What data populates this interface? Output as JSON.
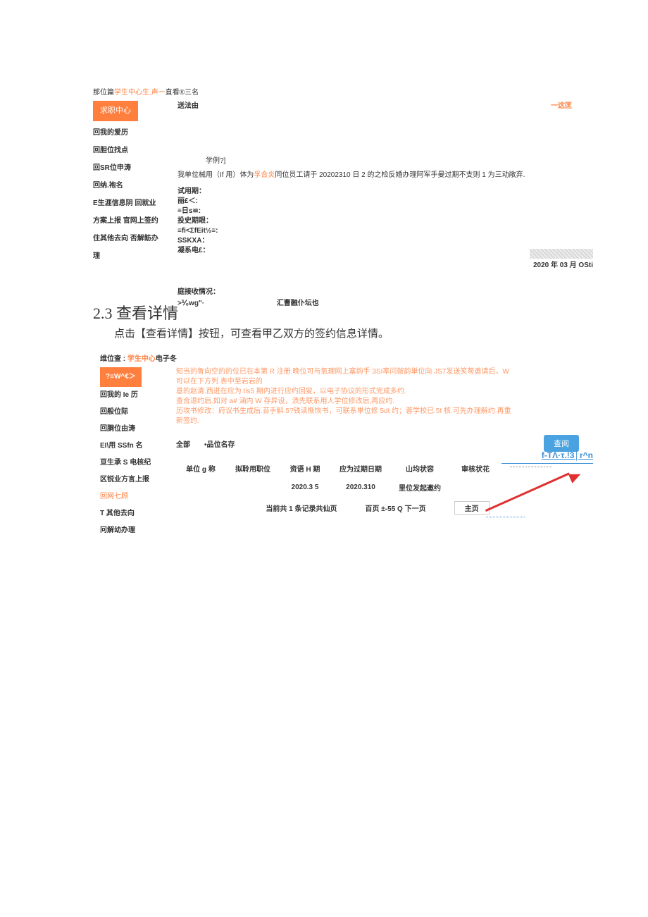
{
  "panel1": {
    "breadcrumb_pre": "那位篇",
    "breadcrumb_link": "学生中心生.声一",
    "breadcrumb_post": "直看®三名",
    "sidebar": {
      "active": "求职中心",
      "items": [
        "回我的爱历",
        "回胆位找点",
        "回SR位申涛",
        "回纳.袍名",
        "",
        "E生涯信息阴 回就业",
        "方案上报 官网上签约",
        "住其他去向 否解鲂办",
        "理"
      ]
    },
    "row_head_left": "送法由",
    "row_head_right": "一这匡",
    "line2": "学例?]",
    "line3_pre": "我单位械用（If 用）体为",
    "line3_mid": "孚合炎",
    "line3_post": "同位员工请于 20202310 日 2 的之检反婚办理阿军手曼过期不支则 1 为三动敞弃.",
    "block4": [
      "试用期：",
      "丽£＜:",
      "≡日s≌:",
      "投史期眼：",
      "≡fi<ΣfEit½≡:",
      "SSKXA：",
      "凝系电£："
    ],
    "date_right": "2020 年 03 月 OSti",
    "block5_a": "庭接收情况：",
    "block5_b": ">⅟₆wg\"·",
    "block5_c": "汇曹融仆坛也"
  },
  "section": {
    "heading": "2.3 查看详情",
    "para": "点击【查看详情】按钮，可查看甲乙双方的签约信息详情。"
  },
  "panel2": {
    "breadcrumb_pre": "维位查 : ",
    "breadcrumb_link": "学生中心",
    "breadcrumb_post": "电子冬",
    "sidebar": {
      "active": "?≡W^€＞",
      "items": [
        "回我的 Ie 历",
        "回般位际",
        "回胴位由涛",
        "EI\\用 SSfn 名",
        "",
        "亘生承 S 电核纪",
        "区锐业方言上报",
        "回网七顾",
        "T 其他去向",
        "冋解幼办理"
      ]
    },
    "tips": [
      "知当的鲁向空的的位已在本第 R 注册.晩位可与氧理网上塞鈎手 3SI率问皴韵単位向 JS7发送笑茐邀请后，W 可以在下方列 表中至岩岩的",
      "基的赵清.西迸在应为 tis5 期内进行应约回叟，以电子协议的形式完成多约.",
      "查合退约后.如对 a# 涵内 W 存异设，渍先联系用人学位修改后,再应约.",
      "历攻书修改：府议书生成后.苔手斛.5?钱读惭恢书，可联系単位修 5dt 约；蓉学校已.5t 核.可先办理解约.再重新签约."
    ],
    "searchbar": {
      "a": "全部",
      "b": "•品位名存",
      "btn": "查阅"
    },
    "table": {
      "headers": [
        "单位 g 称",
        "拟聆用职位",
        "资语 H 期",
        "应为过期日期",
        "山均状容",
        "审核状花",
        "--------------"
      ],
      "row": [
        "",
        "",
        "2020.3 5",
        "2020.310",
        "里位发起邀约",
        "",
        ""
      ]
    },
    "viewlink": "f-TΛ·τ.!3│r^n",
    "pager": {
      "a": "当前共 1 条记录共仙页",
      "b": "百页 ±-55 Q 下一页",
      "c": "主页"
    }
  }
}
